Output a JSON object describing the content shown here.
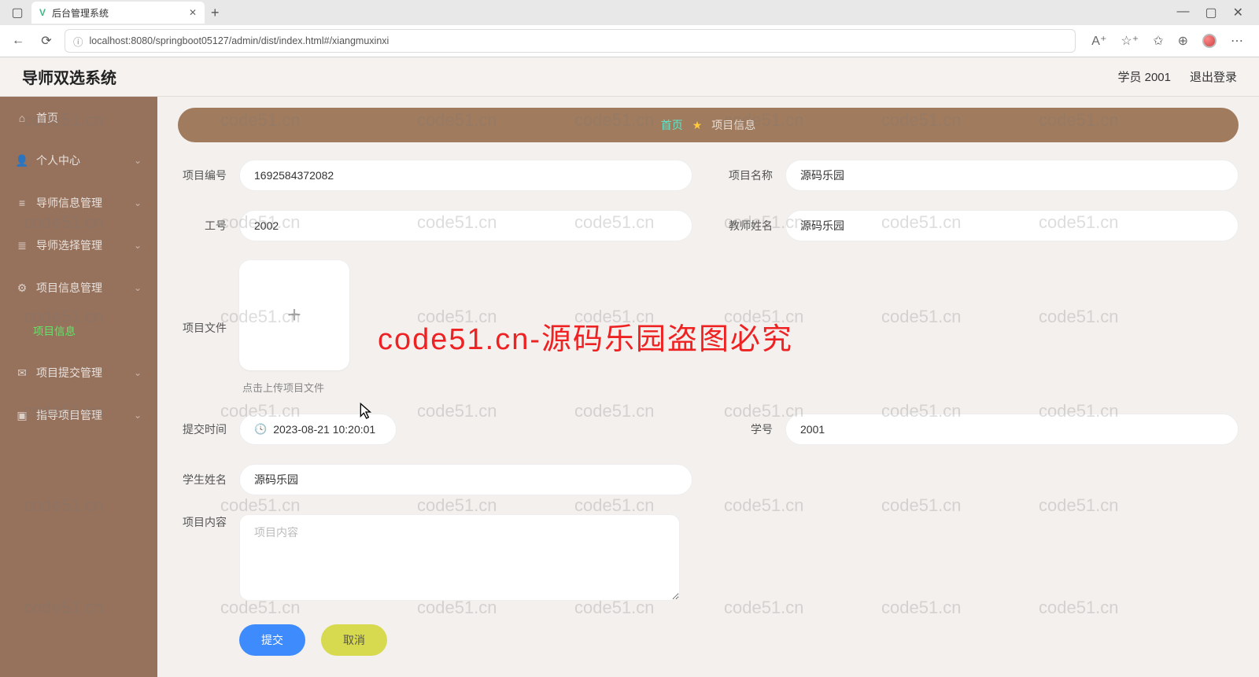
{
  "browser": {
    "tab_title": "后台管理系统",
    "url": "localhost:8080/springboot05127/admin/dist/index.html#/xiangmuxinxi"
  },
  "header": {
    "brand": "导师双选系统",
    "user_label": "学员 2001",
    "logout": "退出登录"
  },
  "sidebar": {
    "home": "首页",
    "personal": "个人中心",
    "teacher_info": "导师信息管理",
    "teacher_select": "导师选择管理",
    "project_info": "项目信息管理",
    "project_info_child": "项目信息",
    "project_submit": "项目提交管理",
    "guide_project": "指导项目管理"
  },
  "breadcrumb": {
    "home": "首页",
    "current": "项目信息"
  },
  "form": {
    "labels": {
      "project_no": "项目编号",
      "project_name": "项目名称",
      "job_no": "工号",
      "teacher_name": "教师姓名",
      "project_file": "项目文件",
      "upload_hint": "点击上传项目文件",
      "submit_time": "提交时间",
      "student_no": "学号",
      "student_name": "学生姓名",
      "project_content": "项目内容"
    },
    "values": {
      "project_no": "1692584372082",
      "project_name": "源码乐园",
      "job_no": "2002",
      "teacher_name": "源码乐园",
      "submit_time": "2023-08-21 10:20:01",
      "student_no": "2001",
      "student_name": "源码乐园",
      "project_content": ""
    },
    "placeholders": {
      "project_content": "项目内容"
    }
  },
  "actions": {
    "submit": "提交",
    "cancel": "取消"
  },
  "watermark": {
    "small": "code51.cn",
    "big": "code51.cn-源码乐园盗图必究"
  }
}
